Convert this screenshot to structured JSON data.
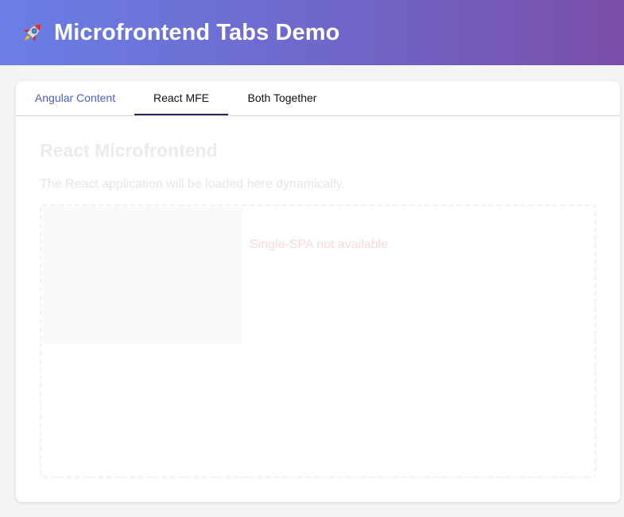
{
  "header": {
    "icon": "rocket-icon",
    "title": "Microfrontend Tabs Demo",
    "gradient_start": "#6a7fe6",
    "gradient_end": "#7a4fa9"
  },
  "tabs": [
    {
      "label": "Angular Content",
      "active": false
    },
    {
      "label": "React MFE",
      "active": true
    },
    {
      "label": "Both Together",
      "active": false
    }
  ],
  "panel": {
    "title": "React Microfrontend",
    "description": "The React application will be loaded here dynamically.",
    "status": "Single-SPA not available"
  },
  "colors": {
    "link_tab": "#4a5fbf",
    "active_underline": "#2a2a5a",
    "error": "#fbd8d8"
  }
}
